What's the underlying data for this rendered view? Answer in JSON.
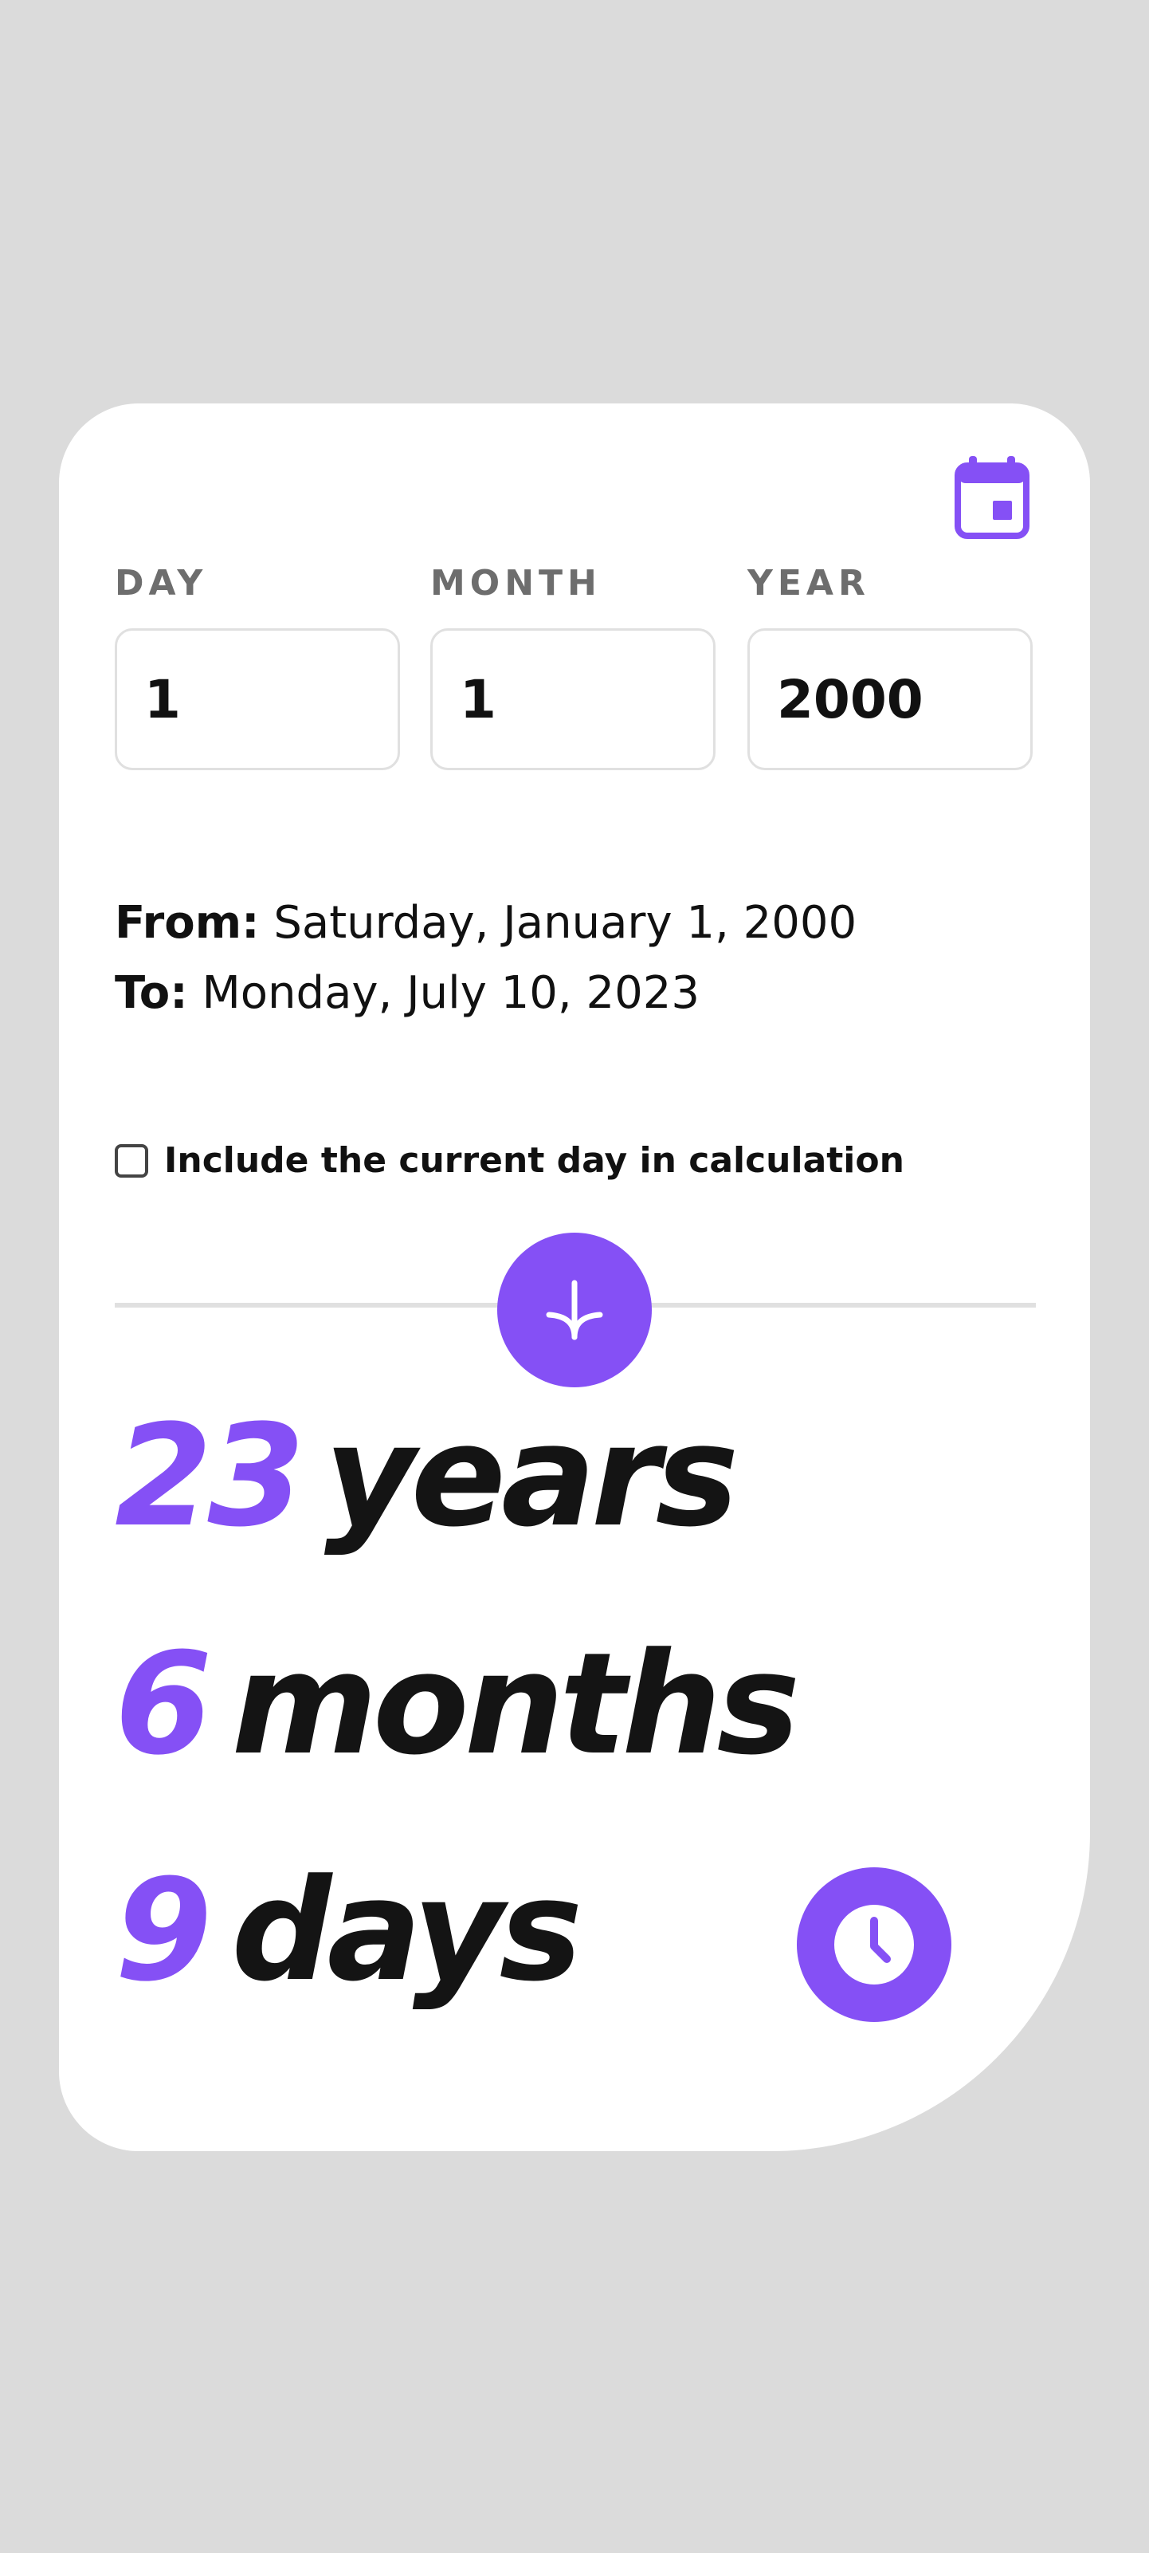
{
  "fields": {
    "day": {
      "label": "DAY",
      "value": "1"
    },
    "month": {
      "label": "MONTH",
      "value": "1"
    },
    "year": {
      "label": "YEAR",
      "value": "2000"
    }
  },
  "summary": {
    "from_label": "From:",
    "from_value": "Saturday, January 1, 2000",
    "to_label": "To:",
    "to_value": "Monday, July 10, 2023"
  },
  "option": {
    "include_current_day_label": "Include the current day in calculation",
    "checked": false
  },
  "result": {
    "years_value": "23",
    "years_label": "years",
    "months_value": "6",
    "months_label": "months",
    "days_value": "9",
    "days_label": "days"
  },
  "icons": {
    "calendar": "calendar-icon",
    "submit": "arrow-down-icon",
    "clock": "clock-icon"
  },
  "colors": {
    "accent": "#8550f5",
    "background": "#dbdbdb",
    "card": "#ffffff"
  }
}
